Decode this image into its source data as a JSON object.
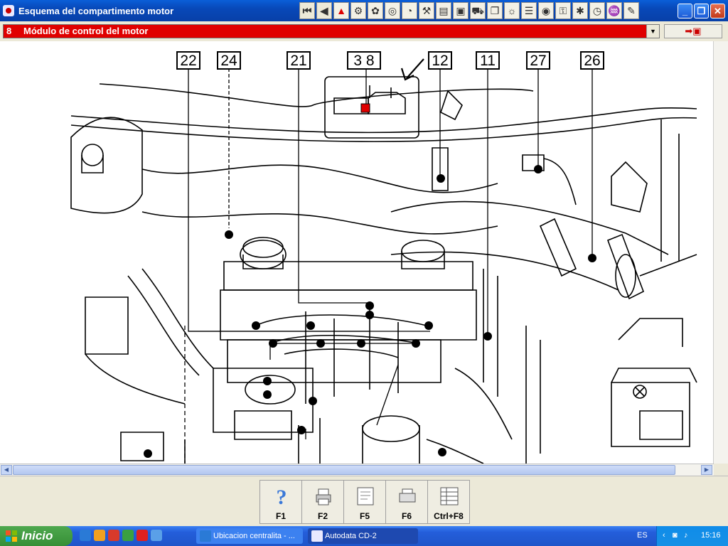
{
  "window": {
    "title": "Esquema del compartimento motor",
    "min_label": "_",
    "max_label": "❐",
    "close_label": "✕"
  },
  "toolbar": {
    "icons": [
      "first-icon",
      "prev-icon",
      "warning-icon",
      "tool-icon",
      "engine-icon",
      "wheel-icon",
      "gauge-icon",
      "wrench-icon",
      "diagram-icon",
      "battery-icon",
      "car-icon",
      "book-icon",
      "light-icon",
      "list-icon",
      "tyre-icon",
      "key-icon",
      "fan-icon",
      "clock-icon",
      "spray-icon",
      "note-icon"
    ]
  },
  "module": {
    "number": "8",
    "name": "Módulo de control del motor"
  },
  "callouts": [
    {
      "id": "22",
      "label": "22"
    },
    {
      "id": "24",
      "label": "24"
    },
    {
      "id": "21",
      "label": "21"
    },
    {
      "id": "38",
      "label": "3 8"
    },
    {
      "id": "12",
      "label": "12"
    },
    {
      "id": "11",
      "label": "11"
    },
    {
      "id": "27",
      "label": "27"
    },
    {
      "id": "26",
      "label": "26"
    }
  ],
  "function_keys": [
    {
      "label": "F1",
      "icon": "help-icon"
    },
    {
      "label": "F2",
      "icon": "print-icon"
    },
    {
      "label": "F5",
      "icon": "save-icon"
    },
    {
      "label": "F6",
      "icon": "printer-icon"
    },
    {
      "label": "Ctrl+F8",
      "icon": "table-icon"
    }
  ],
  "taskbar": {
    "start_label": "Inicio",
    "tasks": [
      {
        "label": "Ubicacion centralita - ...",
        "icon": "ie-icon"
      },
      {
        "label": "Autodata CD-2",
        "icon": "autodata-icon"
      }
    ],
    "language": "ES",
    "clock": "15:16"
  }
}
